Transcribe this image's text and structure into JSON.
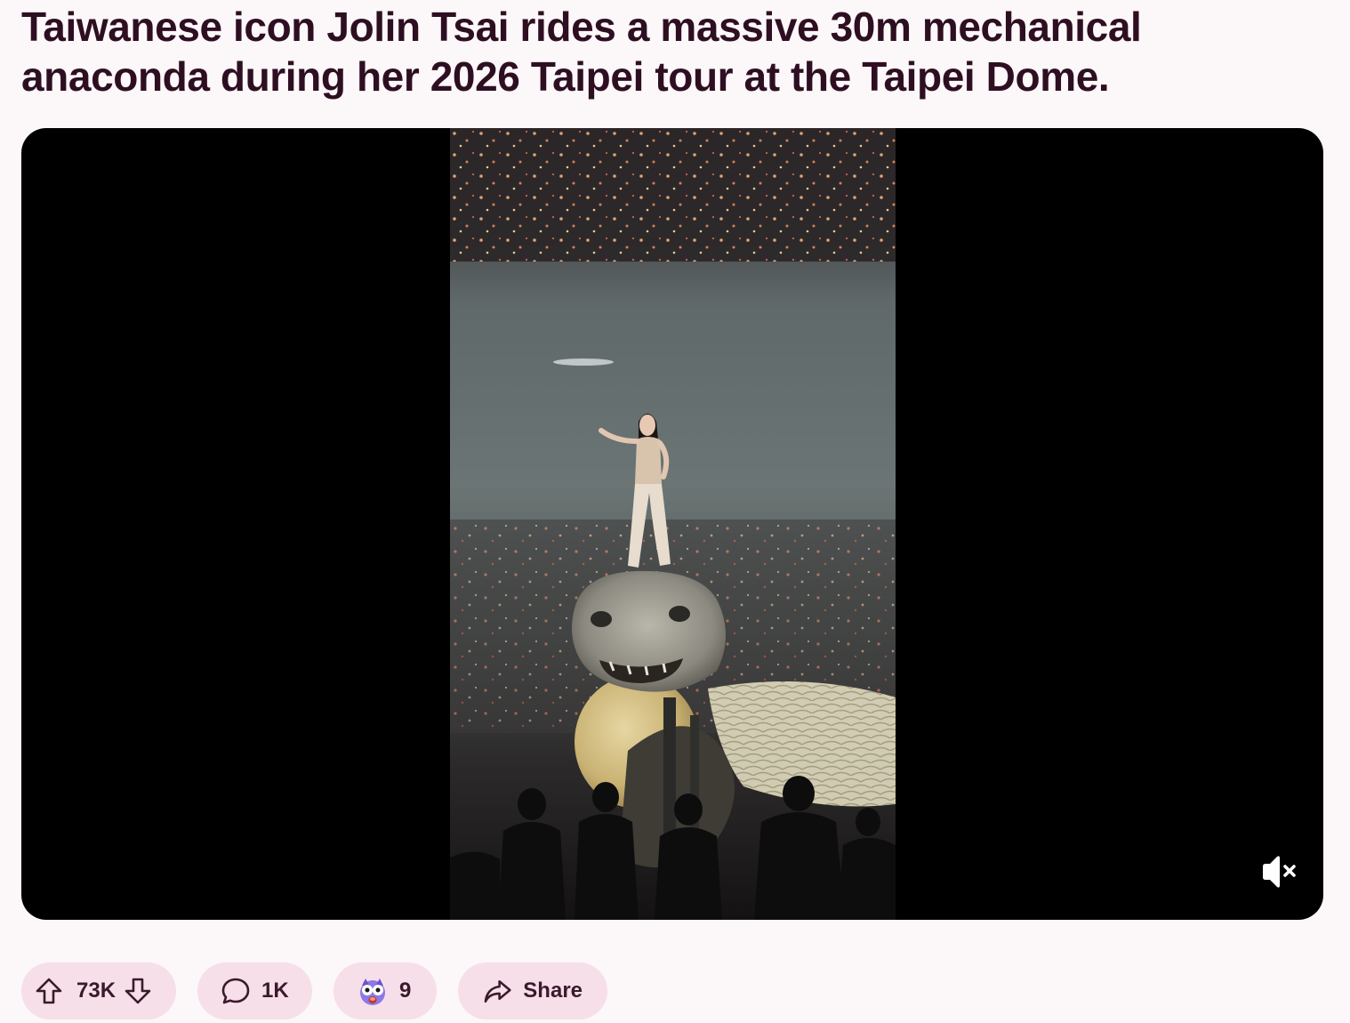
{
  "post": {
    "title": "Taiwanese icon Jolin Tsai rides a massive 30m mechanical anaconda during her 2026 Taipei tour at the Taipei Dome."
  },
  "video": {
    "muted": true,
    "icons": {
      "mute": "speaker-muted-icon"
    }
  },
  "actions": {
    "upvote_count": "73K",
    "comment_count": "1K",
    "award_count": "9",
    "share_label": "Share",
    "icons": {
      "upvote": "arrow-up-icon",
      "downvote": "arrow-down-icon",
      "comment": "speech-bubble-icon",
      "award": "shocked-face-award-icon",
      "share": "share-arrow-icon"
    }
  },
  "colors": {
    "background": "#fcf7f9",
    "title_text": "#2e0f22",
    "pill_background": "#f6dfe8",
    "video_background": "#000000"
  }
}
